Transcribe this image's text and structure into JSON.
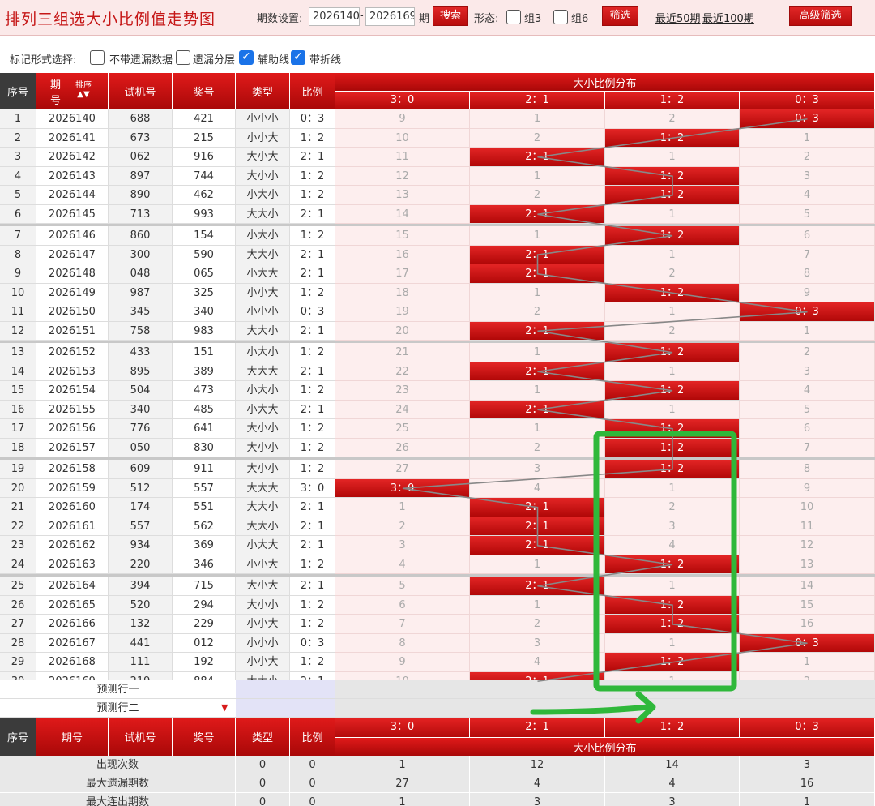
{
  "header": {
    "title": "排列三组选大小比例值走势图",
    "period_label": "期数设置:",
    "period_from": "2026140",
    "period_dash": "-",
    "period_to": "2026169",
    "period_suffix": "期",
    "search_label": "搜索",
    "form_label": "形态:",
    "group3_label": "组3",
    "group6_label": "组6",
    "filter_label": "筛选",
    "last50_label": "最近50期",
    "last100_label": "最近100期",
    "advanced_label": "高级筛选"
  },
  "options": {
    "label": "标记形式选择:",
    "items": [
      {
        "label": "不带遗漏数据",
        "checked": false
      },
      {
        "label": "遗漏分层",
        "checked": false
      },
      {
        "label": "辅助线",
        "checked": true
      },
      {
        "label": "带折线",
        "checked": true
      }
    ]
  },
  "table": {
    "columns": [
      "序号",
      "期号",
      "试机号",
      "奖号",
      "类型",
      "比例"
    ],
    "period_col_top": "期",
    "period_col_bottom": "号",
    "sort_label": "排序",
    "dist_title": "大小比例分布",
    "dist_cols": [
      "3：0",
      "2：1",
      "1：2",
      "0：3"
    ],
    "rows": [
      {
        "idx": "1",
        "period": "2026140",
        "trial": "688",
        "prize": "421",
        "type": "小小小",
        "ratio": "0：3",
        "dist": [
          "9",
          "1",
          "2",
          "0：3"
        ],
        "hit": 3
      },
      {
        "idx": "2",
        "period": "2026141",
        "trial": "673",
        "prize": "215",
        "type": "小小大",
        "ratio": "1：2",
        "dist": [
          "10",
          "2",
          "1：2",
          "1"
        ],
        "hit": 2
      },
      {
        "idx": "3",
        "period": "2026142",
        "trial": "062",
        "prize": "916",
        "type": "大小大",
        "ratio": "2：1",
        "dist": [
          "11",
          "2：1",
          "1",
          "2"
        ],
        "hit": 1
      },
      {
        "idx": "4",
        "period": "2026143",
        "trial": "897",
        "prize": "744",
        "type": "大小小",
        "ratio": "1：2",
        "dist": [
          "12",
          "1",
          "1：2",
          "3"
        ],
        "hit": 2
      },
      {
        "idx": "5",
        "period": "2026144",
        "trial": "890",
        "prize": "462",
        "type": "小大小",
        "ratio": "1：2",
        "dist": [
          "13",
          "2",
          "1：2",
          "4"
        ],
        "hit": 2
      },
      {
        "idx": "6",
        "period": "2026145",
        "trial": "713",
        "prize": "993",
        "type": "大大小",
        "ratio": "2：1",
        "dist": [
          "14",
          "2：1",
          "1",
          "5"
        ],
        "hit": 1
      },
      {
        "idx": "7",
        "period": "2026146",
        "trial": "860",
        "prize": "154",
        "type": "小大小",
        "ratio": "1：2",
        "dist": [
          "15",
          "1",
          "1：2",
          "6"
        ],
        "hit": 2
      },
      {
        "idx": "8",
        "period": "2026147",
        "trial": "300",
        "prize": "590",
        "type": "大大小",
        "ratio": "2：1",
        "dist": [
          "16",
          "2：1",
          "1",
          "7"
        ],
        "hit": 1
      },
      {
        "idx": "9",
        "period": "2026148",
        "trial": "048",
        "prize": "065",
        "type": "小大大",
        "ratio": "2：1",
        "dist": [
          "17",
          "2：1",
          "2",
          "8"
        ],
        "hit": 1
      },
      {
        "idx": "10",
        "period": "2026149",
        "trial": "987",
        "prize": "325",
        "type": "小小大",
        "ratio": "1：2",
        "dist": [
          "18",
          "1",
          "1：2",
          "9"
        ],
        "hit": 2
      },
      {
        "idx": "11",
        "period": "2026150",
        "trial": "345",
        "prize": "340",
        "type": "小小小",
        "ratio": "0：3",
        "dist": [
          "19",
          "2",
          "1",
          "0：3"
        ],
        "hit": 3
      },
      {
        "idx": "12",
        "period": "2026151",
        "trial": "758",
        "prize": "983",
        "type": "大大小",
        "ratio": "2：1",
        "dist": [
          "20",
          "2：1",
          "2",
          "1"
        ],
        "hit": 1
      },
      {
        "idx": "13",
        "period": "2026152",
        "trial": "433",
        "prize": "151",
        "type": "小大小",
        "ratio": "1：2",
        "dist": [
          "21",
          "1",
          "1：2",
          "2"
        ],
        "hit": 2
      },
      {
        "idx": "14",
        "period": "2026153",
        "trial": "895",
        "prize": "389",
        "type": "大大大",
        "ratio": "2：1",
        "dist": [
          "22",
          "2：1",
          "1",
          "3"
        ],
        "hit": 1
      },
      {
        "idx": "15",
        "period": "2026154",
        "trial": "504",
        "prize": "473",
        "type": "小大小",
        "ratio": "1：2",
        "dist": [
          "23",
          "1",
          "1：2",
          "4"
        ],
        "hit": 2
      },
      {
        "idx": "16",
        "period": "2026155",
        "trial": "340",
        "prize": "485",
        "type": "小大大",
        "ratio": "2：1",
        "dist": [
          "24",
          "2：1",
          "1",
          "5"
        ],
        "hit": 1
      },
      {
        "idx": "17",
        "period": "2026156",
        "trial": "776",
        "prize": "641",
        "type": "大小小",
        "ratio": "1：2",
        "dist": [
          "25",
          "1",
          "1：2",
          "6"
        ],
        "hit": 2
      },
      {
        "idx": "18",
        "period": "2026157",
        "trial": "050",
        "prize": "830",
        "type": "大小小",
        "ratio": "1：2",
        "dist": [
          "26",
          "2",
          "1：2",
          "7"
        ],
        "hit": 2
      },
      {
        "idx": "19",
        "period": "2026158",
        "trial": "609",
        "prize": "911",
        "type": "大小小",
        "ratio": "1：2",
        "dist": [
          "27",
          "3",
          "1：2",
          "8"
        ],
        "hit": 2
      },
      {
        "idx": "20",
        "period": "2026159",
        "trial": "512",
        "prize": "557",
        "type": "大大大",
        "ratio": "3：0",
        "dist": [
          "3：0",
          "4",
          "1",
          "9"
        ],
        "hit": 0
      },
      {
        "idx": "21",
        "period": "2026160",
        "trial": "174",
        "prize": "551",
        "type": "大大小",
        "ratio": "2：1",
        "dist": [
          "1",
          "2：1",
          "2",
          "10"
        ],
        "hit": 1
      },
      {
        "idx": "22",
        "period": "2026161",
        "trial": "557",
        "prize": "562",
        "type": "大大小",
        "ratio": "2：1",
        "dist": [
          "2",
          "2：1",
          "3",
          "11"
        ],
        "hit": 1
      },
      {
        "idx": "23",
        "period": "2026162",
        "trial": "934",
        "prize": "369",
        "type": "小大大",
        "ratio": "2：1",
        "dist": [
          "3",
          "2：1",
          "4",
          "12"
        ],
        "hit": 1
      },
      {
        "idx": "24",
        "period": "2026163",
        "trial": "220",
        "prize": "346",
        "type": "小小大",
        "ratio": "1：2",
        "dist": [
          "4",
          "1",
          "1：2",
          "13"
        ],
        "hit": 2
      },
      {
        "idx": "25",
        "period": "2026164",
        "trial": "394",
        "prize": "715",
        "type": "大小大",
        "ratio": "2：1",
        "dist": [
          "5",
          "2：1",
          "1",
          "14"
        ],
        "hit": 1
      },
      {
        "idx": "26",
        "period": "2026165",
        "trial": "520",
        "prize": "294",
        "type": "大小小",
        "ratio": "1：2",
        "dist": [
          "6",
          "1",
          "1：2",
          "15"
        ],
        "hit": 2
      },
      {
        "idx": "27",
        "period": "2026166",
        "trial": "132",
        "prize": "229",
        "type": "小小大",
        "ratio": "1：2",
        "dist": [
          "7",
          "2",
          "1：2",
          "16"
        ],
        "hit": 2
      },
      {
        "idx": "28",
        "period": "2026167",
        "trial": "441",
        "prize": "012",
        "type": "小小小",
        "ratio": "0：3",
        "dist": [
          "8",
          "3",
          "1",
          "0：3"
        ],
        "hit": 3
      },
      {
        "idx": "29",
        "period": "2026168",
        "trial": "111",
        "prize": "192",
        "type": "小小大",
        "ratio": "1：2",
        "dist": [
          "9",
          "4",
          "1：2",
          "1"
        ],
        "hit": 2
      },
      {
        "idx": "30",
        "period": "2026169",
        "trial": "219",
        "prize": "884",
        "type": "大大小",
        "ratio": "2：1",
        "dist": [
          "10",
          "2：1",
          "1",
          "2"
        ],
        "hit": 1
      }
    ],
    "predict": [
      "预测行一",
      "预测行二"
    ],
    "stats": [
      {
        "label": "出现次数",
        "type": "0",
        "ratio": "0",
        "vals": [
          "1",
          "12",
          "14",
          "3"
        ]
      },
      {
        "label": "最大遗漏期数",
        "type": "0",
        "ratio": "0",
        "vals": [
          "27",
          "4",
          "4",
          "16"
        ]
      },
      {
        "label": "最大连出期数",
        "type": "0",
        "ratio": "0",
        "vals": [
          "1",
          "3",
          "3",
          "1"
        ]
      }
    ]
  },
  "colors": {
    "accent": "#c51616",
    "annotation": "#2fb83a"
  }
}
